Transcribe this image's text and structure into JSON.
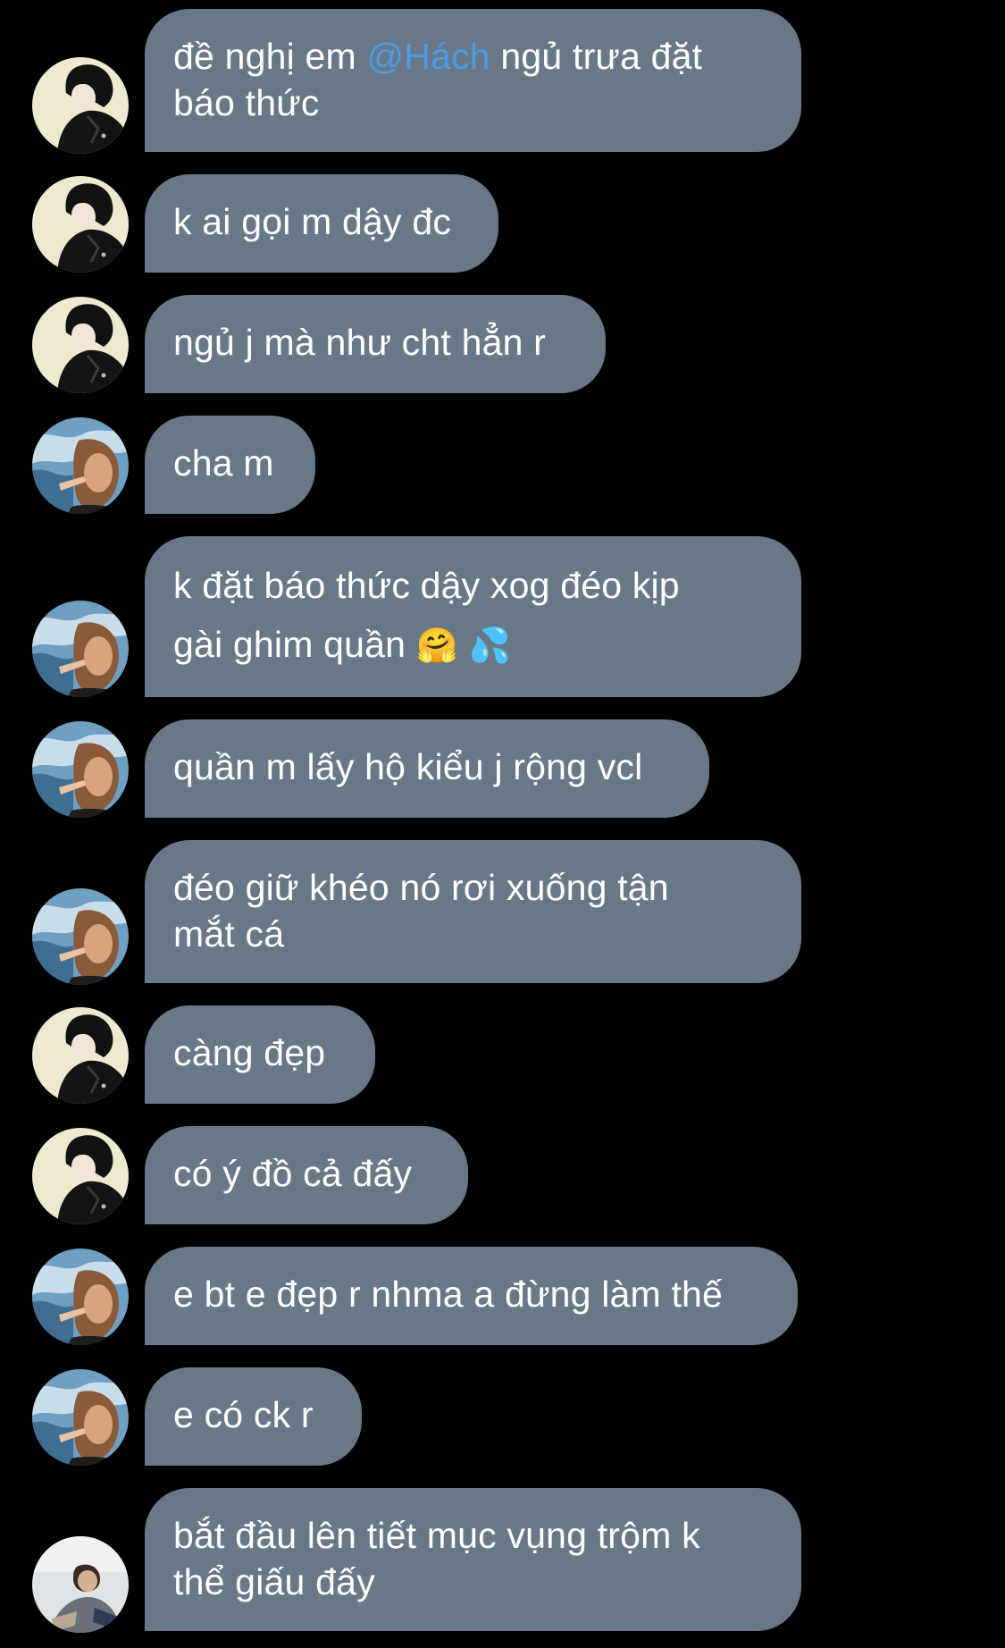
{
  "colors": {
    "background": "#000000",
    "bubble": "#697887",
    "text": "#ffffff",
    "mention": "#4a9be8"
  },
  "messages": [
    {
      "avatar": "avatar-a-icon",
      "pre": "đề nghị em ",
      "mention": "@Hách",
      "post": " ngủ trưa đặt",
      "line2": "báo thức"
    },
    {
      "avatar": "avatar-a-icon",
      "text": "k ai gọi m dậy đc"
    },
    {
      "avatar": "avatar-a-icon",
      "text": "ngủ j mà như cht hẳn r"
    },
    {
      "avatar": "avatar-b-icon",
      "text": "cha m"
    },
    {
      "avatar": "avatar-b-icon",
      "line1": "k đặt báo thức dậy xog đéo kịp",
      "line2": "gài ghim quần",
      "emoji1": "🤗",
      "emoji2": "💦"
    },
    {
      "avatar": "avatar-b-icon",
      "text": "quần m lấy hộ kiểu j rộng vcl"
    },
    {
      "avatar": "avatar-b-icon",
      "line1": "đéo giữ khéo nó rơi xuống tận",
      "line2": "mắt cá"
    },
    {
      "avatar": "avatar-a-icon",
      "text": "càng đẹp"
    },
    {
      "avatar": "avatar-a-icon",
      "text": "có ý đồ cả đấy"
    },
    {
      "avatar": "avatar-b-icon",
      "text": "e bt e đẹp r nhma a đừng làm thế"
    },
    {
      "avatar": "avatar-b-icon",
      "text": "e có ck r"
    },
    {
      "avatar": "avatar-c-icon",
      "line1": "bắt đầu lên tiết mục vụng trộm k",
      "line2": "thể giấu đấy"
    }
  ]
}
